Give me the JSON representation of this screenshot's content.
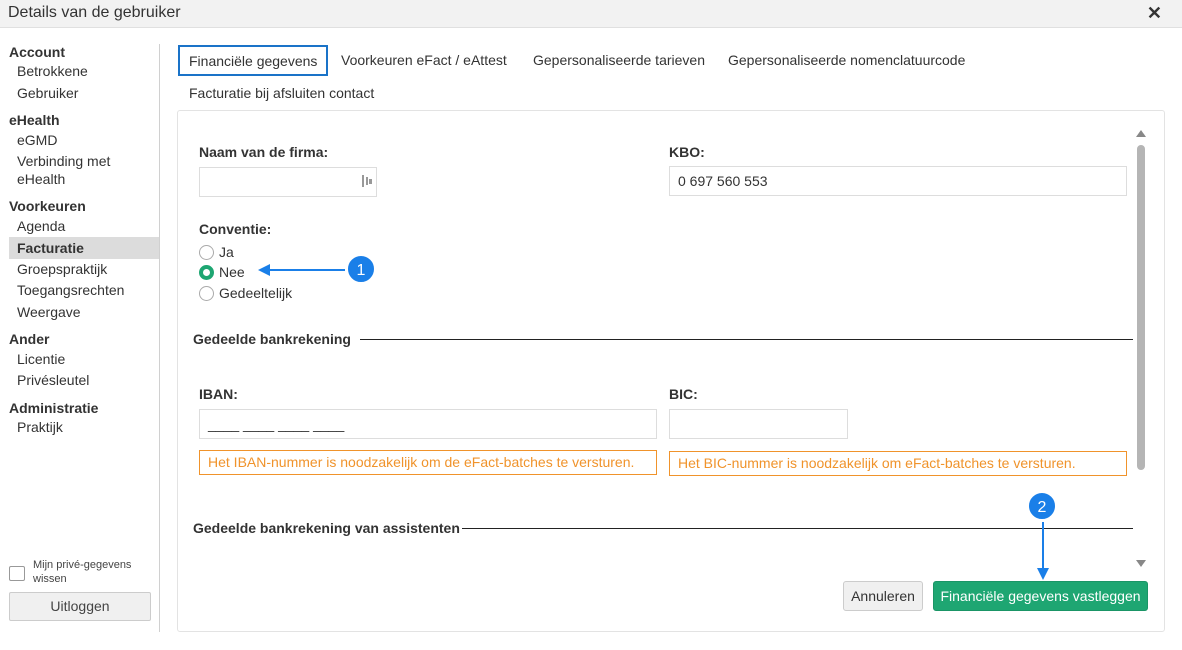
{
  "window": {
    "title": "Details van de gebruiker",
    "close_glyph": "✕"
  },
  "sidebar": {
    "sections": [
      {
        "title": "Account",
        "items": [
          "Betrokkene",
          "Gebruiker"
        ]
      },
      {
        "title": "eHealth",
        "items": [
          "eGMD",
          "Verbinding met eHealth"
        ]
      },
      {
        "title": "Voorkeuren",
        "items": [
          "Agenda",
          "Facturatie",
          "Groepspraktijk",
          "Toegangsrechten",
          "Weergave"
        ]
      },
      {
        "title": "Ander",
        "items": [
          "Licentie",
          "Privésleutel"
        ]
      },
      {
        "title": "Administratie",
        "items": [
          "Praktijk"
        ]
      }
    ],
    "active_item": "Facturatie",
    "privacy_checkbox_label": "Mijn privé-gegevens wissen",
    "privacy_checked": false,
    "logout_label": "Uitloggen"
  },
  "tabs": [
    "Financiële gegevens",
    "Voorkeuren eFact / eAttest",
    "Gepersonaliseerde tarieven",
    "Gepersonaliseerde nomenclatuurcode",
    "Facturatie bij afsluiten contact"
  ],
  "active_tab": "Financiële gegevens",
  "form": {
    "firm_label": "Naam van de firma:",
    "firm_value": "",
    "kbo_label": "KBO:",
    "kbo_value": "0 697 560 553",
    "convention_label": "Conventie:",
    "convention_options": [
      "Ja",
      "Nee",
      "Gedeeltelijk"
    ],
    "convention_selected": "Nee",
    "bank_section": "Gedeelde bankrekening",
    "iban_label": "IBAN:",
    "iban_value": "____ ____ ____ ____",
    "iban_warning": "Het IBAN-nummer is noodzakelijk om de eFact-batches te versturen.",
    "bic_label": "BIC:",
    "bic_value": "",
    "bic_warning": "Het BIC-nummer is noodzakelijk om eFact-batches te versturen.",
    "assistant_section": "Gedeelde bankrekening van assistenten"
  },
  "buttons": {
    "cancel": "Annuleren",
    "save": "Financiële gegevens vastleggen"
  },
  "annotations": [
    "1",
    "2"
  ],
  "colors": {
    "accent_blue": "#1a7fe8",
    "primary_green": "#1ea672",
    "warning_orange": "#f0932b",
    "active_tab_border": "#1a73c8"
  }
}
